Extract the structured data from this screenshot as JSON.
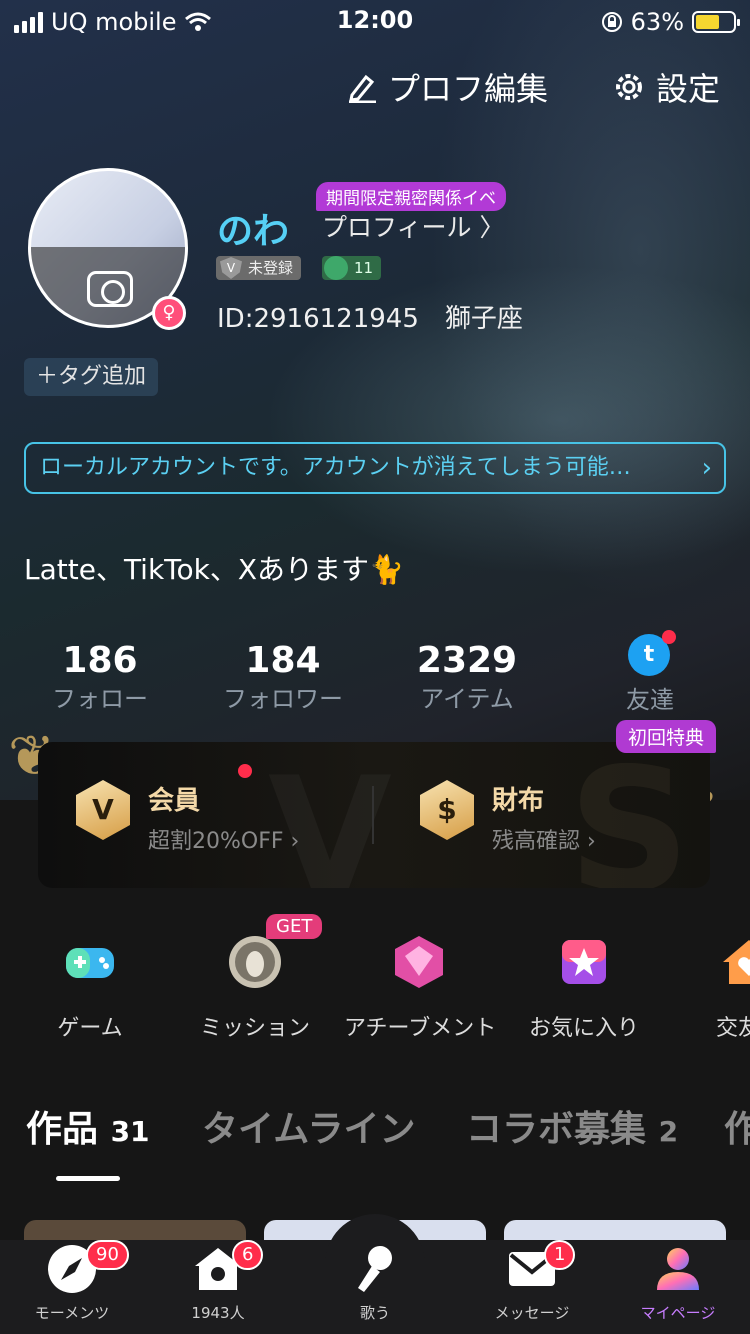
{
  "status_bar": {
    "carrier": "UQ mobile",
    "time": "12:00",
    "battery": "63%",
    "battery_level": 0.63
  },
  "header": {
    "edit_profile": "プロフ編集",
    "settings": "設定"
  },
  "profile": {
    "name": "のわ",
    "event_badge": "期間限定親密関係イベ",
    "profile_link": "プロフィール 〉",
    "badge_unregistered": "未登録",
    "badge_level": "11",
    "id_line": "ID:2916121945　獅子座",
    "tag_add": "＋タグ追加",
    "notice": "ローカルアカウントです。アカウントが消えてしまう可能…",
    "bio": "Latte、TikTok、Xあります🐈"
  },
  "stats": [
    {
      "value": "186",
      "label": "フォロー"
    },
    {
      "value": "184",
      "label": "フォロワー"
    },
    {
      "value": "2329",
      "label": "アイテム"
    }
  ],
  "friends_label": "友達",
  "first_badge": "初回特典",
  "vip": {
    "member_title": "会員",
    "member_sub": "超割20%OFF ›",
    "wallet_title": "財布",
    "wallet_sub": "残高確認 ›"
  },
  "features": {
    "get_badge": "GET",
    "items": [
      "ゲーム",
      "ミッション",
      "アチーブメント",
      "お気に入り",
      "交友ス"
    ]
  },
  "tabs": [
    {
      "label": "作品",
      "count": "31"
    },
    {
      "label": "タイムライン",
      "count": ""
    },
    {
      "label": "コラボ募集",
      "count": "2"
    },
    {
      "label": "作",
      "count": ""
    }
  ],
  "nav": {
    "moments": "モーメンツ",
    "moments_badge": "90",
    "home": "1943人",
    "home_badge": "6",
    "sing": "歌う",
    "message": "メッセージ",
    "message_badge": "1",
    "mypage": "マイページ"
  },
  "colors": {
    "accent": "#56d0f5",
    "vip_gold": "#f4d9a8",
    "badge_red": "#ff2d4b",
    "purple": "#b23ad6"
  }
}
